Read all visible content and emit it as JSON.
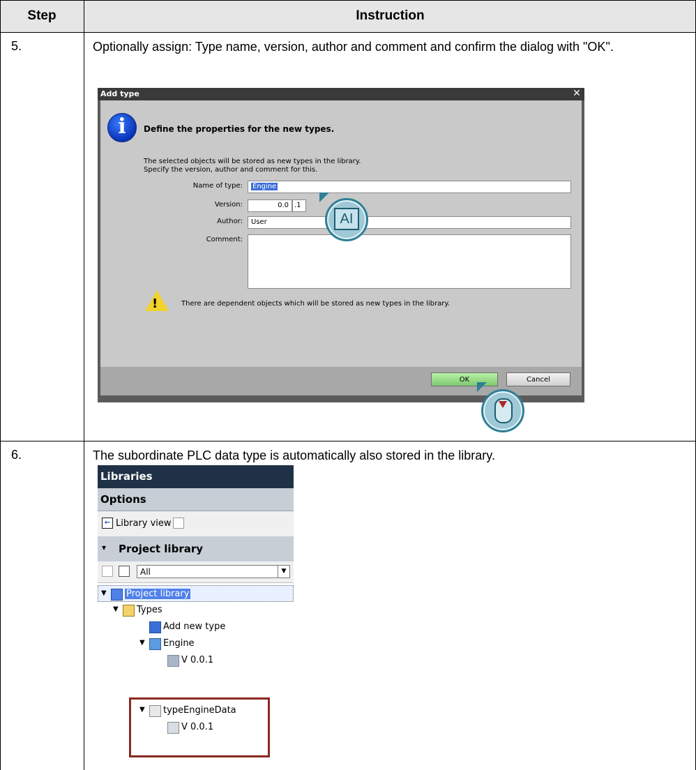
{
  "table": {
    "headers": {
      "step": "Step",
      "instruction": "Instruction"
    },
    "rows": [
      {
        "step": "5.",
        "instruction": "Optionally assign: Type name, version, author and comment and confirm the dialog with \"OK\"."
      },
      {
        "step": "6.",
        "instruction": "The subordinate PLC data type is automatically also stored in the library."
      }
    ]
  },
  "dialog": {
    "title": "Add type",
    "close_glyph": "✕",
    "heading": "Define the properties for the new types.",
    "desc_line1": "The selected objects will be stored as new types in the library.",
    "desc_line2": "Specify the version, author and comment for this.",
    "fields": {
      "name_label": "Name of type:",
      "name_value": "Engine",
      "version_label": "Version:",
      "version_major": "0.0",
      "version_minor": ".1",
      "author_label": "Author:",
      "author_value": "User",
      "comment_label": "Comment:",
      "comment_value": ""
    },
    "warning": "There are dependent objects which will be stored as new types in the library.",
    "buttons": {
      "ok": "OK",
      "cancel": "Cancel"
    },
    "callout_ai": "AI"
  },
  "libraries": {
    "header": "Libraries",
    "options": "Options",
    "library_view": "Library view",
    "project_library": "Project library",
    "filter_value": "All",
    "tree": {
      "root": "Project library",
      "types": "Types",
      "add_new_type": "Add new type",
      "engine": "Engine",
      "engine_version": "V 0.0.1",
      "engine_data": "typeEngineData",
      "engine_data_version": "V 0.0.1"
    }
  },
  "colors": {
    "header_bg": "#e6e6e6",
    "highlight_border": "#8b2a20",
    "selection_blue": "#4f80e8",
    "ok_green": "#7ec870"
  }
}
